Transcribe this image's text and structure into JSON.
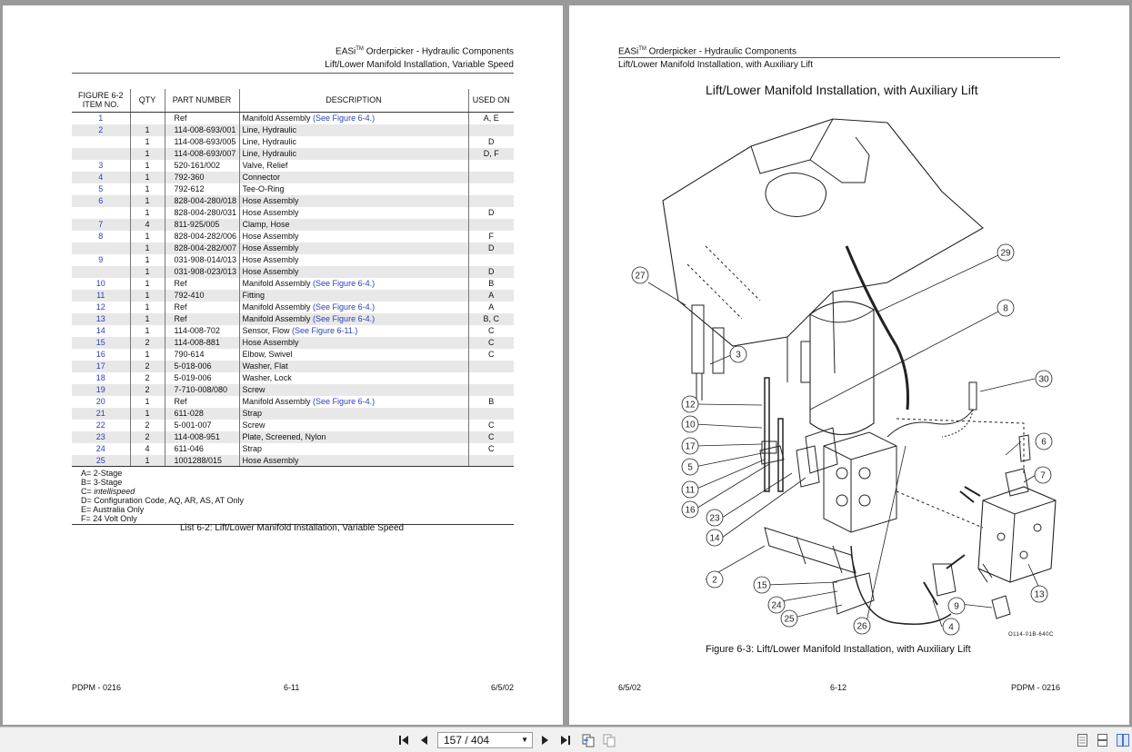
{
  "left_page": {
    "header_title": "EASi",
    "header_tm": "TM",
    "header_rest": " Orderpicker - Hydraulic Components",
    "header_sub": "Lift/Lower Manifold Installation, Variable Speed",
    "table": {
      "headers": [
        "FIGURE 6-2\nITEM NO.",
        "QTY",
        "PART NUMBER",
        "DESCRIPTION",
        "USED ON"
      ],
      "rows": [
        {
          "item": "1",
          "qty": "",
          "part": "Ref",
          "desc": "Manifold Assembly",
          "ref": "(See Figure 6-4.)",
          "used": "A, E"
        },
        {
          "item": "2",
          "qty": "1",
          "part": "114-008-693/001",
          "desc": "Line, Hydraulic",
          "ref": "",
          "used": ""
        },
        {
          "item": "",
          "qty": "1",
          "part": "114-008-693/005",
          "desc": "Line, Hydraulic",
          "ref": "",
          "used": "D"
        },
        {
          "item": "",
          "qty": "1",
          "part": "114-008-693/007",
          "desc": "Line, Hydraulic",
          "ref": "",
          "used": "D, F"
        },
        {
          "item": "3",
          "qty": "1",
          "part": "520-161/002",
          "desc": "Valve, Relief",
          "ref": "",
          "used": ""
        },
        {
          "item": "4",
          "qty": "1",
          "part": "792-360",
          "desc": "Connector",
          "ref": "",
          "used": ""
        },
        {
          "item": "5",
          "qty": "1",
          "part": "792-612",
          "desc": "Tee-O-Ring",
          "ref": "",
          "used": ""
        },
        {
          "item": "6",
          "qty": "1",
          "part": "828-004-280/018",
          "desc": "Hose Assembly",
          "ref": "",
          "used": ""
        },
        {
          "item": "",
          "qty": "1",
          "part": "828-004-280/031",
          "desc": "Hose Assembly",
          "ref": "",
          "used": "D"
        },
        {
          "item": "7",
          "qty": "4",
          "part": "811-925/005",
          "desc": "Clamp, Hose",
          "ref": "",
          "used": ""
        },
        {
          "item": "8",
          "qty": "1",
          "part": "828-004-282/006",
          "desc": "Hose Assembly",
          "ref": "",
          "used": "F"
        },
        {
          "item": "",
          "qty": "1",
          "part": "828-004-282/007",
          "desc": "Hose Assembly",
          "ref": "",
          "used": "D"
        },
        {
          "item": "9",
          "qty": "1",
          "part": "031-908-014/013",
          "desc": "Hose Assembly",
          "ref": "",
          "used": ""
        },
        {
          "item": "",
          "qty": "1",
          "part": "031-908-023/013",
          "desc": "Hose Assembly",
          "ref": "",
          "used": "D"
        },
        {
          "item": "10",
          "qty": "1",
          "part": "Ref",
          "desc": "Manifold Assembly",
          "ref": "(See Figure 6-4.)",
          "used": "B"
        },
        {
          "item": "11",
          "qty": "1",
          "part": "792-410",
          "desc": "Fitting",
          "ref": "",
          "used": "A"
        },
        {
          "item": "12",
          "qty": "1",
          "part": "Ref",
          "desc": "Manifold Assembly",
          "ref": "(See Figure 6-4.)",
          "used": "A"
        },
        {
          "item": "13",
          "qty": "1",
          "part": "Ref",
          "desc": "Manifold Assembly",
          "ref": "(See Figure 6-4.)",
          "used": "B, C"
        },
        {
          "item": "14",
          "qty": "1",
          "part": "114-008-702",
          "desc": "Sensor, Flow",
          "ref": "(See Figure 6-11.)",
          "used": "C"
        },
        {
          "item": "15",
          "qty": "2",
          "part": "114-008-881",
          "desc": "Hose Assembly",
          "ref": "",
          "used": "C"
        },
        {
          "item": "16",
          "qty": "1",
          "part": "790-614",
          "desc": "Elbow, Swivel",
          "ref": "",
          "used": "C"
        },
        {
          "item": "17",
          "qty": "2",
          "part": "5-018-006",
          "desc": "Washer, Flat",
          "ref": "",
          "used": ""
        },
        {
          "item": "18",
          "qty": "2",
          "part": "5-019-006",
          "desc": "Washer, Lock",
          "ref": "",
          "used": ""
        },
        {
          "item": "19",
          "qty": "2",
          "part": "7-710-008/080",
          "desc": "Screw",
          "ref": "",
          "used": ""
        },
        {
          "item": "20",
          "qty": "1",
          "part": "Ref",
          "desc": "Manifold Assembly",
          "ref": "(See Figure 6-4.)",
          "used": "B"
        },
        {
          "item": "21",
          "qty": "1",
          "part": "611-028",
          "desc": "Strap",
          "ref": "",
          "used": ""
        },
        {
          "item": "22",
          "qty": "2",
          "part": "5-001-007",
          "desc": "Screw",
          "ref": "",
          "used": "C"
        },
        {
          "item": "23",
          "qty": "2",
          "part": "114-008-951",
          "desc": "Plate, Screened, Nylon",
          "ref": "",
          "used": "C"
        },
        {
          "item": "24",
          "qty": "4",
          "part": "611-046",
          "desc": "Strap",
          "ref": "",
          "used": "C"
        },
        {
          "item": "25",
          "qty": "1",
          "part": "1001288/015",
          "desc": "Hose Assembly",
          "ref": "",
          "used": ""
        }
      ]
    },
    "legend": [
      "A= 2-Stage",
      "B= 3-Stage",
      "C= intellispeed",
      "D= Configuration Code, AQ, AR, AS, AT Only",
      "E= Australia Only",
      "F= 24 Volt Only"
    ],
    "caption": "List 6-2:  Lift/Lower Manifold Installation, Variable Speed",
    "footer_left": "PDPM - 0216",
    "footer_center": "6-11",
    "footer_right": "6/5/02"
  },
  "right_page": {
    "header_title": "EASi",
    "header_tm": "TM",
    "header_rest": " Orderpicker - Hydraulic Components",
    "header_sub": "Lift/Lower Manifold Installation, with Auxiliary Lift",
    "figure_title": "Lift/Lower Manifold Installation, with Auxiliary Lift",
    "callouts": [
      "27",
      "29",
      "8",
      "3",
      "30",
      "12",
      "10",
      "17",
      "6",
      "5",
      "7",
      "11",
      "16",
      "23",
      "14",
      "2",
      "15",
      "24",
      "25",
      "26",
      "4",
      "9",
      "13"
    ],
    "figure_code": "O114-01B-640C",
    "figure_caption": "Figure 6-3:  Lift/Lower Manifold Installation, with Auxiliary Lift",
    "footer_left": "6/5/02",
    "footer_center": "6-12",
    "footer_right": "PDPM - 0216"
  },
  "toolbar": {
    "page_indicator": "157 / 404",
    "icons": [
      "first-page-icon",
      "prev-page-icon",
      "next-page-icon",
      "last-page-icon",
      "prev-view-icon",
      "next-view-icon",
      "single-page-view-icon",
      "continuous-view-icon",
      "facing-pages-view-icon"
    ]
  }
}
